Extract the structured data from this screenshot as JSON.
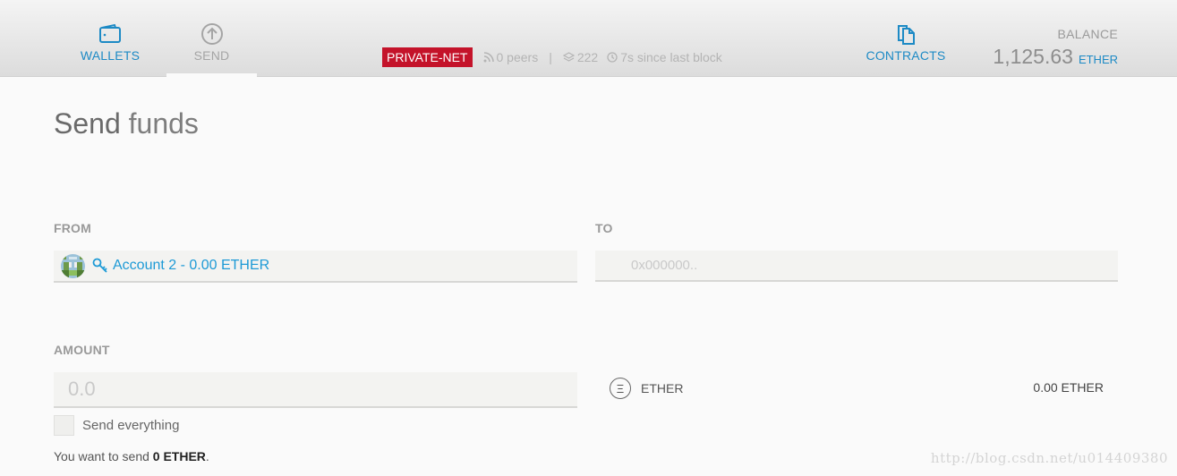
{
  "nav": {
    "wallets": "WALLETS",
    "send": "SEND",
    "contracts": "CONTRACTS"
  },
  "status": {
    "network": "PRIVATE-NET",
    "peers": "0 peers",
    "blocks": "222",
    "last_block": "7s since last block"
  },
  "balance": {
    "label": "BALANCE",
    "value": "1,125.63",
    "unit": "ETHER"
  },
  "page": {
    "title_bold": "Send",
    "title_rest": " funds"
  },
  "form": {
    "from_label": "FROM",
    "from_value": "Account 2 - 0.00 ETHER",
    "to_label": "TO",
    "to_placeholder": "0x000000..",
    "amount_label": "AMOUNT",
    "amount_placeholder": "0.0",
    "currency_symbol": "Ξ",
    "currency_name": "ETHER",
    "currency_amount": "0.00 ETHER",
    "send_everything": "Send everything",
    "summary_prefix": "You want to send ",
    "summary_amount": "0 ETHER",
    "summary_suffix": "."
  },
  "watermark": "http://blog.csdn.net/u014409380",
  "colors": {
    "accent": "#1d8ac5",
    "badge": "#c4132a"
  },
  "icons": {
    "wallets": "wallet-icon",
    "send": "arrow-up-circle-icon",
    "contracts": "documents-icon",
    "peers": "signal-icon",
    "blocks": "layers-icon",
    "time": "clock-icon",
    "key": "key-icon"
  }
}
